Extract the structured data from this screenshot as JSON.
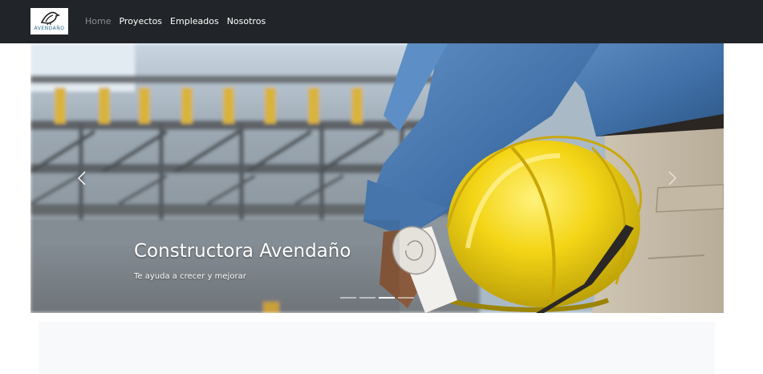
{
  "brand": {
    "text": "AVENDAÑO",
    "icon": "bird-logo-icon"
  },
  "nav": {
    "links": [
      {
        "label": "Home",
        "active": true
      },
      {
        "label": "Proyectos",
        "active": false
      },
      {
        "label": "Empleados",
        "active": false
      },
      {
        "label": "Nosotros",
        "active": false
      }
    ]
  },
  "carousel": {
    "title": "Constructora Avendaño",
    "subtitle": "Te ayuda a crecer y mejorar",
    "indicators": 4,
    "active_indicator": 3,
    "prev_icon": "chevron-left-icon",
    "next_icon": "chevron-right-icon"
  },
  "colors": {
    "navbar": "#212529",
    "helmet": "#f2d21a",
    "denim": "#4a7bb3",
    "content_bg": "#f8f9fa"
  }
}
